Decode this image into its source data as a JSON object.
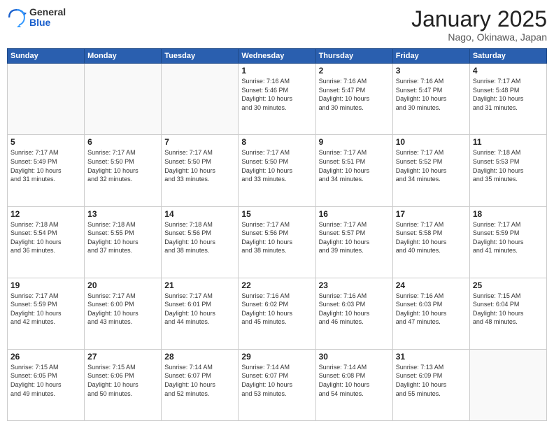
{
  "logo": {
    "general": "General",
    "blue": "Blue"
  },
  "header": {
    "title": "January 2025",
    "subtitle": "Nago, Okinawa, Japan"
  },
  "weekdays": [
    "Sunday",
    "Monday",
    "Tuesday",
    "Wednesday",
    "Thursday",
    "Friday",
    "Saturday"
  ],
  "days": [
    {
      "num": "",
      "info": ""
    },
    {
      "num": "",
      "info": ""
    },
    {
      "num": "",
      "info": ""
    },
    {
      "num": "1",
      "info": "Sunrise: 7:16 AM\nSunset: 5:46 PM\nDaylight: 10 hours\nand 30 minutes."
    },
    {
      "num": "2",
      "info": "Sunrise: 7:16 AM\nSunset: 5:47 PM\nDaylight: 10 hours\nand 30 minutes."
    },
    {
      "num": "3",
      "info": "Sunrise: 7:16 AM\nSunset: 5:47 PM\nDaylight: 10 hours\nand 30 minutes."
    },
    {
      "num": "4",
      "info": "Sunrise: 7:17 AM\nSunset: 5:48 PM\nDaylight: 10 hours\nand 31 minutes."
    },
    {
      "num": "5",
      "info": "Sunrise: 7:17 AM\nSunset: 5:49 PM\nDaylight: 10 hours\nand 31 minutes."
    },
    {
      "num": "6",
      "info": "Sunrise: 7:17 AM\nSunset: 5:50 PM\nDaylight: 10 hours\nand 32 minutes."
    },
    {
      "num": "7",
      "info": "Sunrise: 7:17 AM\nSunset: 5:50 PM\nDaylight: 10 hours\nand 33 minutes."
    },
    {
      "num": "8",
      "info": "Sunrise: 7:17 AM\nSunset: 5:50 PM\nDaylight: 10 hours\nand 33 minutes."
    },
    {
      "num": "9",
      "info": "Sunrise: 7:17 AM\nSunset: 5:51 PM\nDaylight: 10 hours\nand 34 minutes."
    },
    {
      "num": "10",
      "info": "Sunrise: 7:17 AM\nSunset: 5:52 PM\nDaylight: 10 hours\nand 34 minutes."
    },
    {
      "num": "11",
      "info": "Sunrise: 7:18 AM\nSunset: 5:53 PM\nDaylight: 10 hours\nand 35 minutes."
    },
    {
      "num": "12",
      "info": "Sunrise: 7:18 AM\nSunset: 5:54 PM\nDaylight: 10 hours\nand 36 minutes."
    },
    {
      "num": "13",
      "info": "Sunrise: 7:18 AM\nSunset: 5:55 PM\nDaylight: 10 hours\nand 37 minutes."
    },
    {
      "num": "14",
      "info": "Sunrise: 7:18 AM\nSunset: 5:56 PM\nDaylight: 10 hours\nand 38 minutes."
    },
    {
      "num": "15",
      "info": "Sunrise: 7:17 AM\nSunset: 5:56 PM\nDaylight: 10 hours\nand 38 minutes."
    },
    {
      "num": "16",
      "info": "Sunrise: 7:17 AM\nSunset: 5:57 PM\nDaylight: 10 hours\nand 39 minutes."
    },
    {
      "num": "17",
      "info": "Sunrise: 7:17 AM\nSunset: 5:58 PM\nDaylight: 10 hours\nand 40 minutes."
    },
    {
      "num": "18",
      "info": "Sunrise: 7:17 AM\nSunset: 5:59 PM\nDaylight: 10 hours\nand 41 minutes."
    },
    {
      "num": "19",
      "info": "Sunrise: 7:17 AM\nSunset: 5:59 PM\nDaylight: 10 hours\nand 42 minutes."
    },
    {
      "num": "20",
      "info": "Sunrise: 7:17 AM\nSunset: 6:00 PM\nDaylight: 10 hours\nand 43 minutes."
    },
    {
      "num": "21",
      "info": "Sunrise: 7:17 AM\nSunset: 6:01 PM\nDaylight: 10 hours\nand 44 minutes."
    },
    {
      "num": "22",
      "info": "Sunrise: 7:16 AM\nSunset: 6:02 PM\nDaylight: 10 hours\nand 45 minutes."
    },
    {
      "num": "23",
      "info": "Sunrise: 7:16 AM\nSunset: 6:03 PM\nDaylight: 10 hours\nand 46 minutes."
    },
    {
      "num": "24",
      "info": "Sunrise: 7:16 AM\nSunset: 6:03 PM\nDaylight: 10 hours\nand 47 minutes."
    },
    {
      "num": "25",
      "info": "Sunrise: 7:15 AM\nSunset: 6:04 PM\nDaylight: 10 hours\nand 48 minutes."
    },
    {
      "num": "26",
      "info": "Sunrise: 7:15 AM\nSunset: 6:05 PM\nDaylight: 10 hours\nand 49 minutes."
    },
    {
      "num": "27",
      "info": "Sunrise: 7:15 AM\nSunset: 6:06 PM\nDaylight: 10 hours\nand 50 minutes."
    },
    {
      "num": "28",
      "info": "Sunrise: 7:14 AM\nSunset: 6:07 PM\nDaylight: 10 hours\nand 52 minutes."
    },
    {
      "num": "29",
      "info": "Sunrise: 7:14 AM\nSunset: 6:07 PM\nDaylight: 10 hours\nand 53 minutes."
    },
    {
      "num": "30",
      "info": "Sunrise: 7:14 AM\nSunset: 6:08 PM\nDaylight: 10 hours\nand 54 minutes."
    },
    {
      "num": "31",
      "info": "Sunrise: 7:13 AM\nSunset: 6:09 PM\nDaylight: 10 hours\nand 55 minutes."
    },
    {
      "num": "",
      "info": ""
    }
  ]
}
